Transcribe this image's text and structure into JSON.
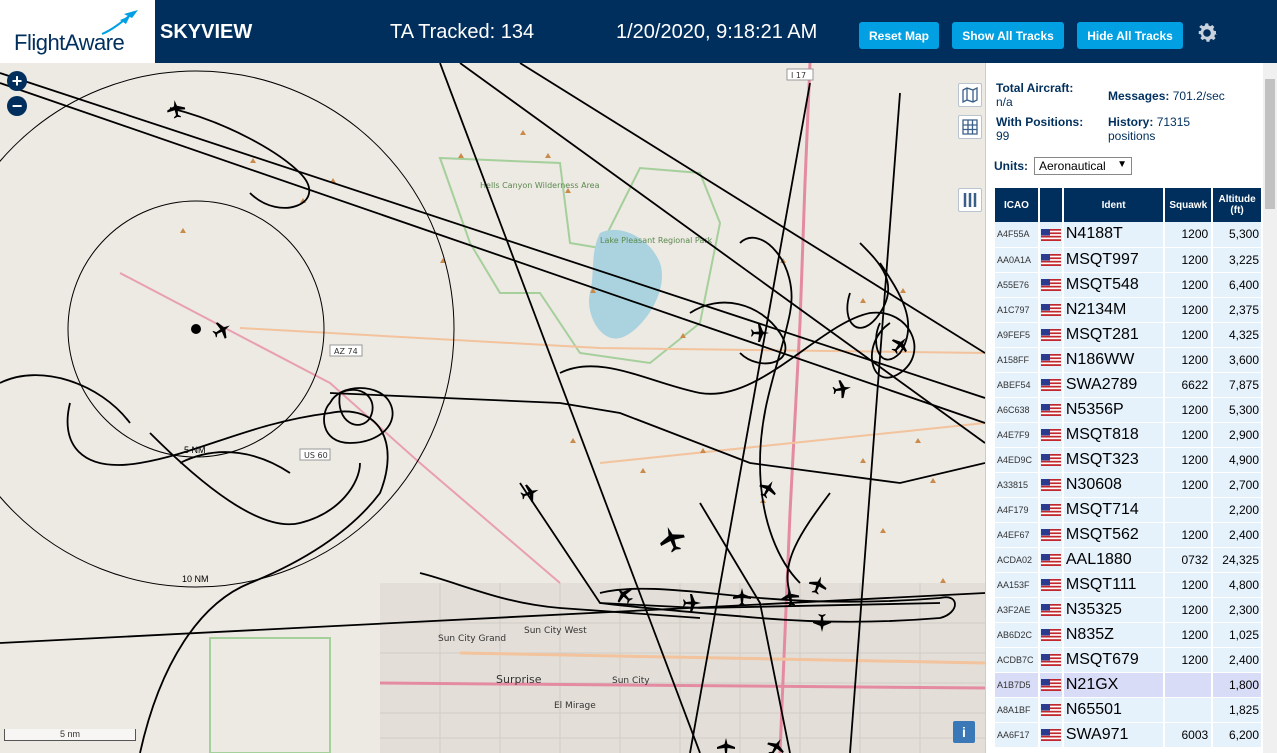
{
  "header": {
    "logo_text": "FlightAware",
    "app_name": "SKYVIEW",
    "tracked": "TA Tracked: 134",
    "clock": "1/20/2020, 9:18:21 AM",
    "reset_label": "Reset Map",
    "show_label": "Show All Tracks",
    "hide_label": "Hide All Tracks",
    "settings_icon": "gear-icon"
  },
  "map": {
    "zoom_in": "+",
    "zoom_out": "−",
    "scale_label": "5 nm",
    "ring_5": "5 NM",
    "ring_10": "10 NM",
    "info": "i",
    "places": [
      "Hells Canyon Wilderness Area",
      "Lake Pleasant Regional Park",
      "Sun City Grand",
      "Sun City West",
      "Surprise",
      "Sun City",
      "El Mirage",
      "AZ 74",
      "US 60",
      "I 17"
    ]
  },
  "stats": {
    "total_label": "Total Aircraft:",
    "total_value": "n/a",
    "messages_label": "Messages:",
    "messages_value": "701.2/sec",
    "positions_label": "With Positions:",
    "positions_value": "99",
    "history_label": "History:",
    "history_value": "71315",
    "history_unit": "positions",
    "units_label": "Units:",
    "units_value": "Aeronautical"
  },
  "table": {
    "headers": [
      "ICAO",
      "",
      "Ident",
      "Squawk",
      "Altitude (ft)"
    ],
    "rows": [
      {
        "icao": "A4F55A",
        "ident": "N4188T",
        "squawk": "1200",
        "alt": "5,300"
      },
      {
        "icao": "AA0A1A",
        "ident": "MSQT997",
        "squawk": "1200",
        "alt": "3,225"
      },
      {
        "icao": "A55E76",
        "ident": "MSQT548",
        "squawk": "1200",
        "alt": "6,400"
      },
      {
        "icao": "A1C797",
        "ident": "N2134M",
        "squawk": "1200",
        "alt": "2,375"
      },
      {
        "icao": "A9FEF5",
        "ident": "MSQT281",
        "squawk": "1200",
        "alt": "4,325"
      },
      {
        "icao": "A158FF",
        "ident": "N186WW",
        "squawk": "1200",
        "alt": "3,600"
      },
      {
        "icao": "ABEF54",
        "ident": "SWA2789",
        "squawk": "6622",
        "alt": "7,875"
      },
      {
        "icao": "A6C638",
        "ident": "N5356P",
        "squawk": "1200",
        "alt": "5,300"
      },
      {
        "icao": "A4E7F9",
        "ident": "MSQT818",
        "squawk": "1200",
        "alt": "2,900"
      },
      {
        "icao": "A4ED9C",
        "ident": "MSQT323",
        "squawk": "1200",
        "alt": "4,900"
      },
      {
        "icao": "A33815",
        "ident": "N30608",
        "squawk": "1200",
        "alt": "2,700"
      },
      {
        "icao": "A4F179",
        "ident": "MSQT714",
        "squawk": "",
        "alt": "2,200"
      },
      {
        "icao": "A4EF67",
        "ident": "MSQT562",
        "squawk": "1200",
        "alt": "2,400"
      },
      {
        "icao": "ACDA02",
        "ident": "AAL1880",
        "squawk": "0732",
        "alt": "24,325"
      },
      {
        "icao": "AA153F",
        "ident": "MSQT111",
        "squawk": "1200",
        "alt": "4,800"
      },
      {
        "icao": "A3F2AE",
        "ident": "N35325",
        "squawk": "1200",
        "alt": "2,300"
      },
      {
        "icao": "AB6D2C",
        "ident": "N835Z",
        "squawk": "1200",
        "alt": "1,025"
      },
      {
        "icao": "ACDB7C",
        "ident": "MSQT679",
        "squawk": "1200",
        "alt": "2,400"
      },
      {
        "icao": "A1B7D5",
        "ident": "N21GX",
        "squawk": "",
        "alt": "1,800"
      },
      {
        "icao": "A8A1BF",
        "ident": "N65501",
        "squawk": "",
        "alt": "1,825"
      },
      {
        "icao": "AA6F17",
        "ident": "SWA971",
        "squawk": "6003",
        "alt": "6,200"
      }
    ],
    "selected_index": 18
  }
}
